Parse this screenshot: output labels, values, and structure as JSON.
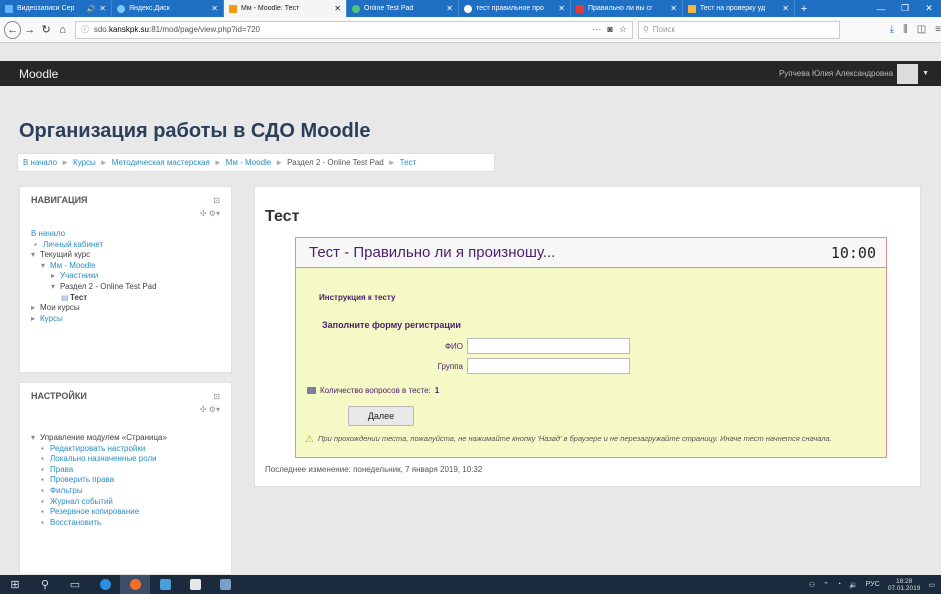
{
  "browser": {
    "tabs": [
      {
        "title": "Видеозаписи Сер",
        "active": false,
        "color": "#5fb8ff",
        "sound": true
      },
      {
        "title": "Яндекс.Диск",
        "active": false,
        "color": "#7bc6ff"
      },
      {
        "title": "Мм - Moodle: Тест",
        "active": true,
        "color": "#f39c12"
      },
      {
        "title": "Online Test Pad",
        "active": false,
        "color": "#4fc37a"
      },
      {
        "title": "тест правильное про",
        "active": false,
        "color": "#2f9e44"
      },
      {
        "title": "Правильно ли вы сг",
        "active": false,
        "color": "#e53935"
      },
      {
        "title": "Тест на проверку уд",
        "active": false,
        "color": "#f6b73c"
      }
    ],
    "url_prefix": "sdo.",
    "url_host": "kanskpk.su",
    "url_rest": ":81/mod/page/view.php?id=720",
    "search_placeholder": "Поиск"
  },
  "header": {
    "brand": "Moodle",
    "user_name": "Рупчева Юлия Александровна"
  },
  "page": {
    "title": "Организация работы в СДО Moodle",
    "breadcrumbs": [
      "В начало",
      "Курсы",
      "Методическая мастерская",
      "Мм - Moodle",
      "Раздел 2 - Online Test Pad",
      "Тест"
    ]
  },
  "navigation": {
    "heading": "НАВИГАЦИЯ",
    "home": "В начало",
    "dashboard": "Личный кабинет",
    "current_course": "Текущий курс",
    "course": "Мм - Moodle",
    "participants": "Участники",
    "section": "Раздел 2 - Online Test Pad",
    "page": "Тест",
    "my_courses": "Мои курсы",
    "courses": "Курсы"
  },
  "settings": {
    "heading": "НАСТРОЙКИ",
    "module_admin": "Управление модулем «Страница»",
    "items": [
      "Редактировать настройки",
      "Локально назначенные роли",
      "Права",
      "Проверить права",
      "Фильтры",
      "Журнал событий",
      "Резервное копирование",
      "Восстановить"
    ]
  },
  "main": {
    "title": "Тест",
    "last_modified": "Последнее изменение: понедельник, 7 января 2019, 10:32"
  },
  "otp": {
    "title": "Тест - Правильно ли я произношу...",
    "timer": "10:00",
    "instructions": "Инструкция к тесту",
    "registration": "Заполните форму регистрации",
    "field_name_label": "ФИО",
    "field_group_label": "Группа",
    "field_name_value": "",
    "field_group_value": "",
    "question_count_label": "Количество вопросов в тесте:",
    "question_count": "1",
    "next_button": "Далее",
    "warning": "При прохождении теста, пожалуйста, не нажимайте кнопку 'Назад' в браузере и не перезагружайте страницу. Иначе тест начнется сначала."
  },
  "taskbar": {
    "lang": "РУС",
    "time": "18:28",
    "date": "07.01.2019"
  }
}
